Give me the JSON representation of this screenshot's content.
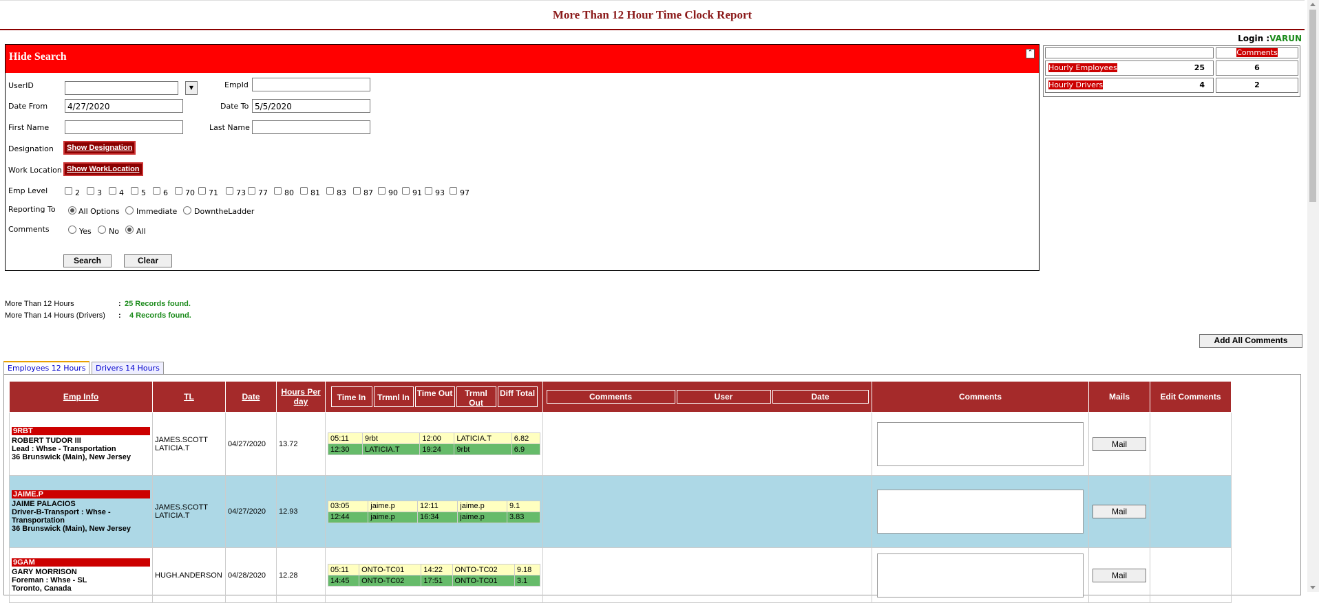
{
  "header": {
    "title": "More Than 12 Hour Time Clock Report",
    "login_label": "Login :",
    "login_user": "VARUN"
  },
  "search": {
    "title": "Hide Search",
    "userid_label": "UserID",
    "userid_value": "",
    "empid_label": "EmpId",
    "empid_value": "",
    "date_from_label": "Date From",
    "date_from_value": "4/27/2020",
    "date_to_label": "Date To",
    "date_to_value": "5/5/2020",
    "first_name_label": "First Name",
    "first_name_value": "",
    "last_name_label": "Last Name",
    "last_name_value": "",
    "designation_label": "Designation",
    "designation_button": "Show Designation",
    "work_location_label": "Work Location",
    "work_location_button": "Show WorkLocation",
    "emp_level_label": "Emp Level",
    "emp_levels": [
      "2",
      "3",
      "4",
      "5",
      "6",
      "70",
      "71",
      "73",
      "77",
      "80",
      "81",
      "83",
      "87",
      "90",
      "91",
      "93",
      "97"
    ],
    "reporting_label": "Reporting To",
    "reporting_options": [
      "All Options",
      "Immediate",
      "DowntheLadder"
    ],
    "reporting_selected": "All Options",
    "comments_label": "Comments",
    "comments_options": [
      "Yes",
      "No",
      "All"
    ],
    "comments_selected": "All",
    "search_button": "Search",
    "clear_button": "Clear"
  },
  "summary": {
    "header_comments": "Comments",
    "rows": [
      {
        "label": "Hourly Employees",
        "count": "25",
        "comments": "6"
      },
      {
        "label": "Hourly Drivers",
        "count": "4",
        "comments": "2"
      }
    ]
  },
  "stats": {
    "line1_label": "More Than 12 Hours",
    "line1_sep": ":",
    "line1_value": "25 Records found.",
    "line2_label": "More Than 14 Hours (Drivers)",
    "line2_sep": ":",
    "line2_value": "4 Records found."
  },
  "add_all_comments": "Add All Comments",
  "tabs": [
    "Employees 12 Hours",
    "Drivers 14 Hours"
  ],
  "grid": {
    "headers": {
      "emp_info": "Emp Info",
      "tl": "TL",
      "date": "Date",
      "hours": "Hours Per day",
      "time_in": "Time In",
      "trmnl_in": "Trmnl In",
      "time_out": "Time Out",
      "trmnl_out": "Trmnl Out",
      "diff_total": "Diff Total",
      "comments_sub": "Comments",
      "user_sub": "User",
      "date_sub": "Date",
      "comments": "Comments",
      "mails": "Mails",
      "edit_comments": "Edit Comments"
    },
    "mail_label": "Mail",
    "rows": [
      {
        "id": "9RBT",
        "name": "ROBERT TUDOR III",
        "role": "Lead : Whse - Transportation",
        "location": "36 Brunswick (Main), New Jersey",
        "tl1": "JAMES.SCOTT",
        "tl2": "LATICIA.T",
        "date": "04/27/2020",
        "hours": "13.72",
        "punches": [
          {
            "in": "05:11",
            "tin": "9rbt",
            "out": "12:00",
            "tout": "LATICIA.T",
            "diff": "6.82"
          },
          {
            "in": "12:30",
            "tin": "LATICIA.T",
            "out": "19:24",
            "tout": "9rbt",
            "diff": "6.9"
          }
        ]
      },
      {
        "id": "JAIME.P",
        "name": "JAIME PALACIOS",
        "role": "Driver-B-Transport : Whse - Transportation",
        "location": "36 Brunswick (Main), New Jersey",
        "tl1": "JAMES.SCOTT",
        "tl2": "LATICIA.T",
        "date": "04/27/2020",
        "hours": "12.93",
        "punches": [
          {
            "in": "03:05",
            "tin": "jaime.p",
            "out": "12:11",
            "tout": "jaime.p",
            "diff": "9.1"
          },
          {
            "in": "12:44",
            "tin": "jaime.p",
            "out": "16:34",
            "tout": "jaime.p",
            "diff": "3.83"
          }
        ]
      },
      {
        "id": "9GAM",
        "name": "GARY MORRISON",
        "role": "Foreman : Whse - SL",
        "location": "Toronto, Canada",
        "tl1": "HUGH.ANDERSON",
        "tl2": "",
        "date": "04/28/2020",
        "hours": "12.28",
        "punches": [
          {
            "in": "05:11",
            "tin": "ONTO-TC01",
            "out": "14:22",
            "tout": "ONTO-TC02",
            "diff": "9.18"
          },
          {
            "in": "14:45",
            "tin": "ONTO-TC02",
            "out": "17:51",
            "tout": "ONTO-TC01",
            "diff": "3.1"
          }
        ]
      }
    ]
  }
}
